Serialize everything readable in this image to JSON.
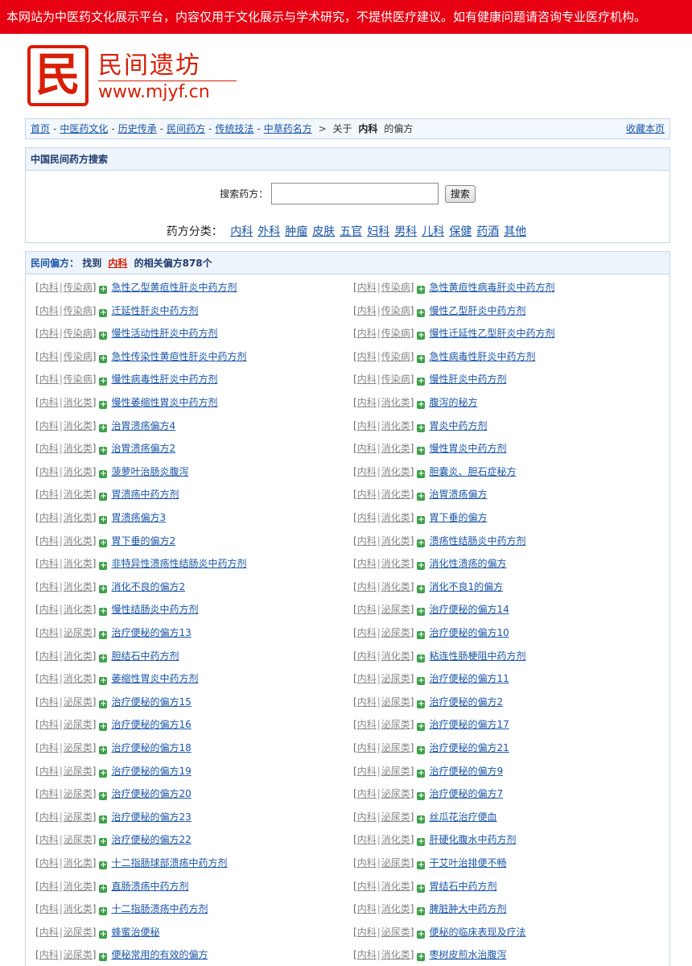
{
  "notice": "本网站为中医药文化展示平台，内容仅用于文化展示与学术研究，不提供医疗建议。如有健康问题请咨询专业医疗机构。",
  "logo": {
    "seal": "民",
    "name": "民间遗坊",
    "url": "www.mjyf.cn",
    "color": "#d81e06"
  },
  "breadcrumb": {
    "links": [
      "首页",
      "中医药文化",
      "历史传承",
      "民间药方",
      "传统技法",
      "中草药名方"
    ],
    "sep": "-",
    "arrow": ">",
    "prefix": "关于",
    "keyword": "内科",
    "suffix": "的偏方",
    "favorite": "收藏本页"
  },
  "search": {
    "title": "中国民间药方搜索",
    "label": "搜索药方：",
    "value": "",
    "placeholder": "",
    "button": "搜索",
    "cat_label": "药方分类：",
    "categories": [
      "内科",
      "外科",
      "肿瘤",
      "皮肤",
      "五官",
      "妇科",
      "男科",
      "儿科",
      "保健",
      "药酒",
      "其他"
    ]
  },
  "results": {
    "title": "民间偏方：",
    "found": "找到",
    "keyword": "内科",
    "count_text": "的相关偏方878个",
    "items": [
      {
        "c": "内科",
        "s": "传染病",
        "t": "急性乙型黄疸性肝炎中药方剂"
      },
      {
        "c": "内科",
        "s": "传染病",
        "t": "急性黄疸性病毒肝炎中药方剂"
      },
      {
        "c": "内科",
        "s": "传染病",
        "t": "迁延性肝炎中药方剂"
      },
      {
        "c": "内科",
        "s": "传染病",
        "t": "慢性乙型肝炎中药方剂"
      },
      {
        "c": "内科",
        "s": "传染病",
        "t": "慢性活动性肝炎中药方剂"
      },
      {
        "c": "内科",
        "s": "传染病",
        "t": "慢性迁延性乙型肝炎中药方剂"
      },
      {
        "c": "内科",
        "s": "传染病",
        "t": "急性传染性黄疸性肝炎中药方剂"
      },
      {
        "c": "内科",
        "s": "传染病",
        "t": "急性病毒性肝炎中药方剂"
      },
      {
        "c": "内科",
        "s": "传染病",
        "t": "慢性病毒性肝炎中药方剂"
      },
      {
        "c": "内科",
        "s": "传染病",
        "t": "慢性肝炎中药方剂"
      },
      {
        "c": "内科",
        "s": "消化类",
        "t": "慢性萎缩性胃炎中药方剂"
      },
      {
        "c": "内科",
        "s": "消化类",
        "t": "腹泻的秘方"
      },
      {
        "c": "内科",
        "s": "消化类",
        "t": "治胃溃疡偏方4"
      },
      {
        "c": "内科",
        "s": "消化类",
        "t": "胃炎中药方剂"
      },
      {
        "c": "内科",
        "s": "消化类",
        "t": "治胃溃疡偏方2"
      },
      {
        "c": "内科",
        "s": "消化类",
        "t": "慢性胃炎中药方剂"
      },
      {
        "c": "内科",
        "s": "消化类",
        "t": "菠萝叶治肠炎腹泻"
      },
      {
        "c": "内科",
        "s": "消化类",
        "t": "胆囊炎、胆石症秘方"
      },
      {
        "c": "内科",
        "s": "消化类",
        "t": "胃溃疡中药方剂"
      },
      {
        "c": "内科",
        "s": "消化类",
        "t": "治胃溃疡偏方"
      },
      {
        "c": "内科",
        "s": "消化类",
        "t": "胃溃疡偏方3"
      },
      {
        "c": "内科",
        "s": "消化类",
        "t": "胃下垂的偏方"
      },
      {
        "c": "内科",
        "s": "消化类",
        "t": "胃下垂的偏方2"
      },
      {
        "c": "内科",
        "s": "消化类",
        "t": "溃疡性结肠炎中药方剂"
      },
      {
        "c": "内科",
        "s": "消化类",
        "t": "非特异性溃疡性结肠炎中药方剂"
      },
      {
        "c": "内科",
        "s": "消化类",
        "t": "消化性溃疡的偏方"
      },
      {
        "c": "内科",
        "s": "消化类",
        "t": "消化不良的偏方2"
      },
      {
        "c": "内科",
        "s": "消化类",
        "t": "消化不良1的偏方"
      },
      {
        "c": "内科",
        "s": "消化类",
        "t": "慢性结肠炎中药方剂"
      },
      {
        "c": "内科",
        "s": "泌尿类",
        "t": "治疗便秘的偏方14"
      },
      {
        "c": "内科",
        "s": "泌尿类",
        "t": "治疗便秘的偏方13"
      },
      {
        "c": "内科",
        "s": "泌尿类",
        "t": "治疗便秘的偏方10"
      },
      {
        "c": "内科",
        "s": "消化类",
        "t": "胆结石中药方剂"
      },
      {
        "c": "内科",
        "s": "消化类",
        "t": "粘连性肠梗阻中药方剂"
      },
      {
        "c": "内科",
        "s": "消化类",
        "t": "萎缩性胃炎中药方剂"
      },
      {
        "c": "内科",
        "s": "泌尿类",
        "t": "治疗便秘的偏方11"
      },
      {
        "c": "内科",
        "s": "泌尿类",
        "t": "治疗便秘的偏方15"
      },
      {
        "c": "内科",
        "s": "泌尿类",
        "t": "治疗便秘的偏方2"
      },
      {
        "c": "内科",
        "s": "泌尿类",
        "t": "治疗便秘的偏方16"
      },
      {
        "c": "内科",
        "s": "泌尿类",
        "t": "治疗便秘的偏方17"
      },
      {
        "c": "内科",
        "s": "泌尿类",
        "t": "治疗便秘的偏方18"
      },
      {
        "c": "内科",
        "s": "泌尿类",
        "t": "治疗便秘的偏方21"
      },
      {
        "c": "内科",
        "s": "泌尿类",
        "t": "治疗便秘的偏方19"
      },
      {
        "c": "内科",
        "s": "泌尿类",
        "t": "治疗便秘的偏方9"
      },
      {
        "c": "内科",
        "s": "泌尿类",
        "t": "治疗便秘的偏方20"
      },
      {
        "c": "内科",
        "s": "泌尿类",
        "t": "治疗便秘的偏方7"
      },
      {
        "c": "内科",
        "s": "泌尿类",
        "t": "治疗便秘的偏方23"
      },
      {
        "c": "内科",
        "s": "泌尿类",
        "t": "丝瓜花治疗便血"
      },
      {
        "c": "内科",
        "s": "泌尿类",
        "t": "治疗便秘的偏方22"
      },
      {
        "c": "内科",
        "s": "消化类",
        "t": "肝硬化腹水中药方剂"
      },
      {
        "c": "内科",
        "s": "消化类",
        "t": "十二指肠球部溃疡中药方剂"
      },
      {
        "c": "内科",
        "s": "泌尿类",
        "t": "干艾叶治排便不畅"
      },
      {
        "c": "内科",
        "s": "消化类",
        "t": "直肠溃疡中药方剂"
      },
      {
        "c": "内科",
        "s": "消化类",
        "t": "胃结石中药方剂"
      },
      {
        "c": "内科",
        "s": "消化类",
        "t": "十二指肠溃疡中药方剂"
      },
      {
        "c": "内科",
        "s": "消化类",
        "t": "脾脏肿大中药方剂"
      },
      {
        "c": "内科",
        "s": "泌尿类",
        "t": "蜂蜜治便秘"
      },
      {
        "c": "内科",
        "s": "泌尿类",
        "t": "便秘的临床表现及疗法"
      },
      {
        "c": "内科",
        "s": "泌尿类",
        "t": "便秘常用的有效的偏方"
      },
      {
        "c": "内科",
        "s": "消化类",
        "t": "枣树皮煎水治腹泻"
      }
    ]
  }
}
